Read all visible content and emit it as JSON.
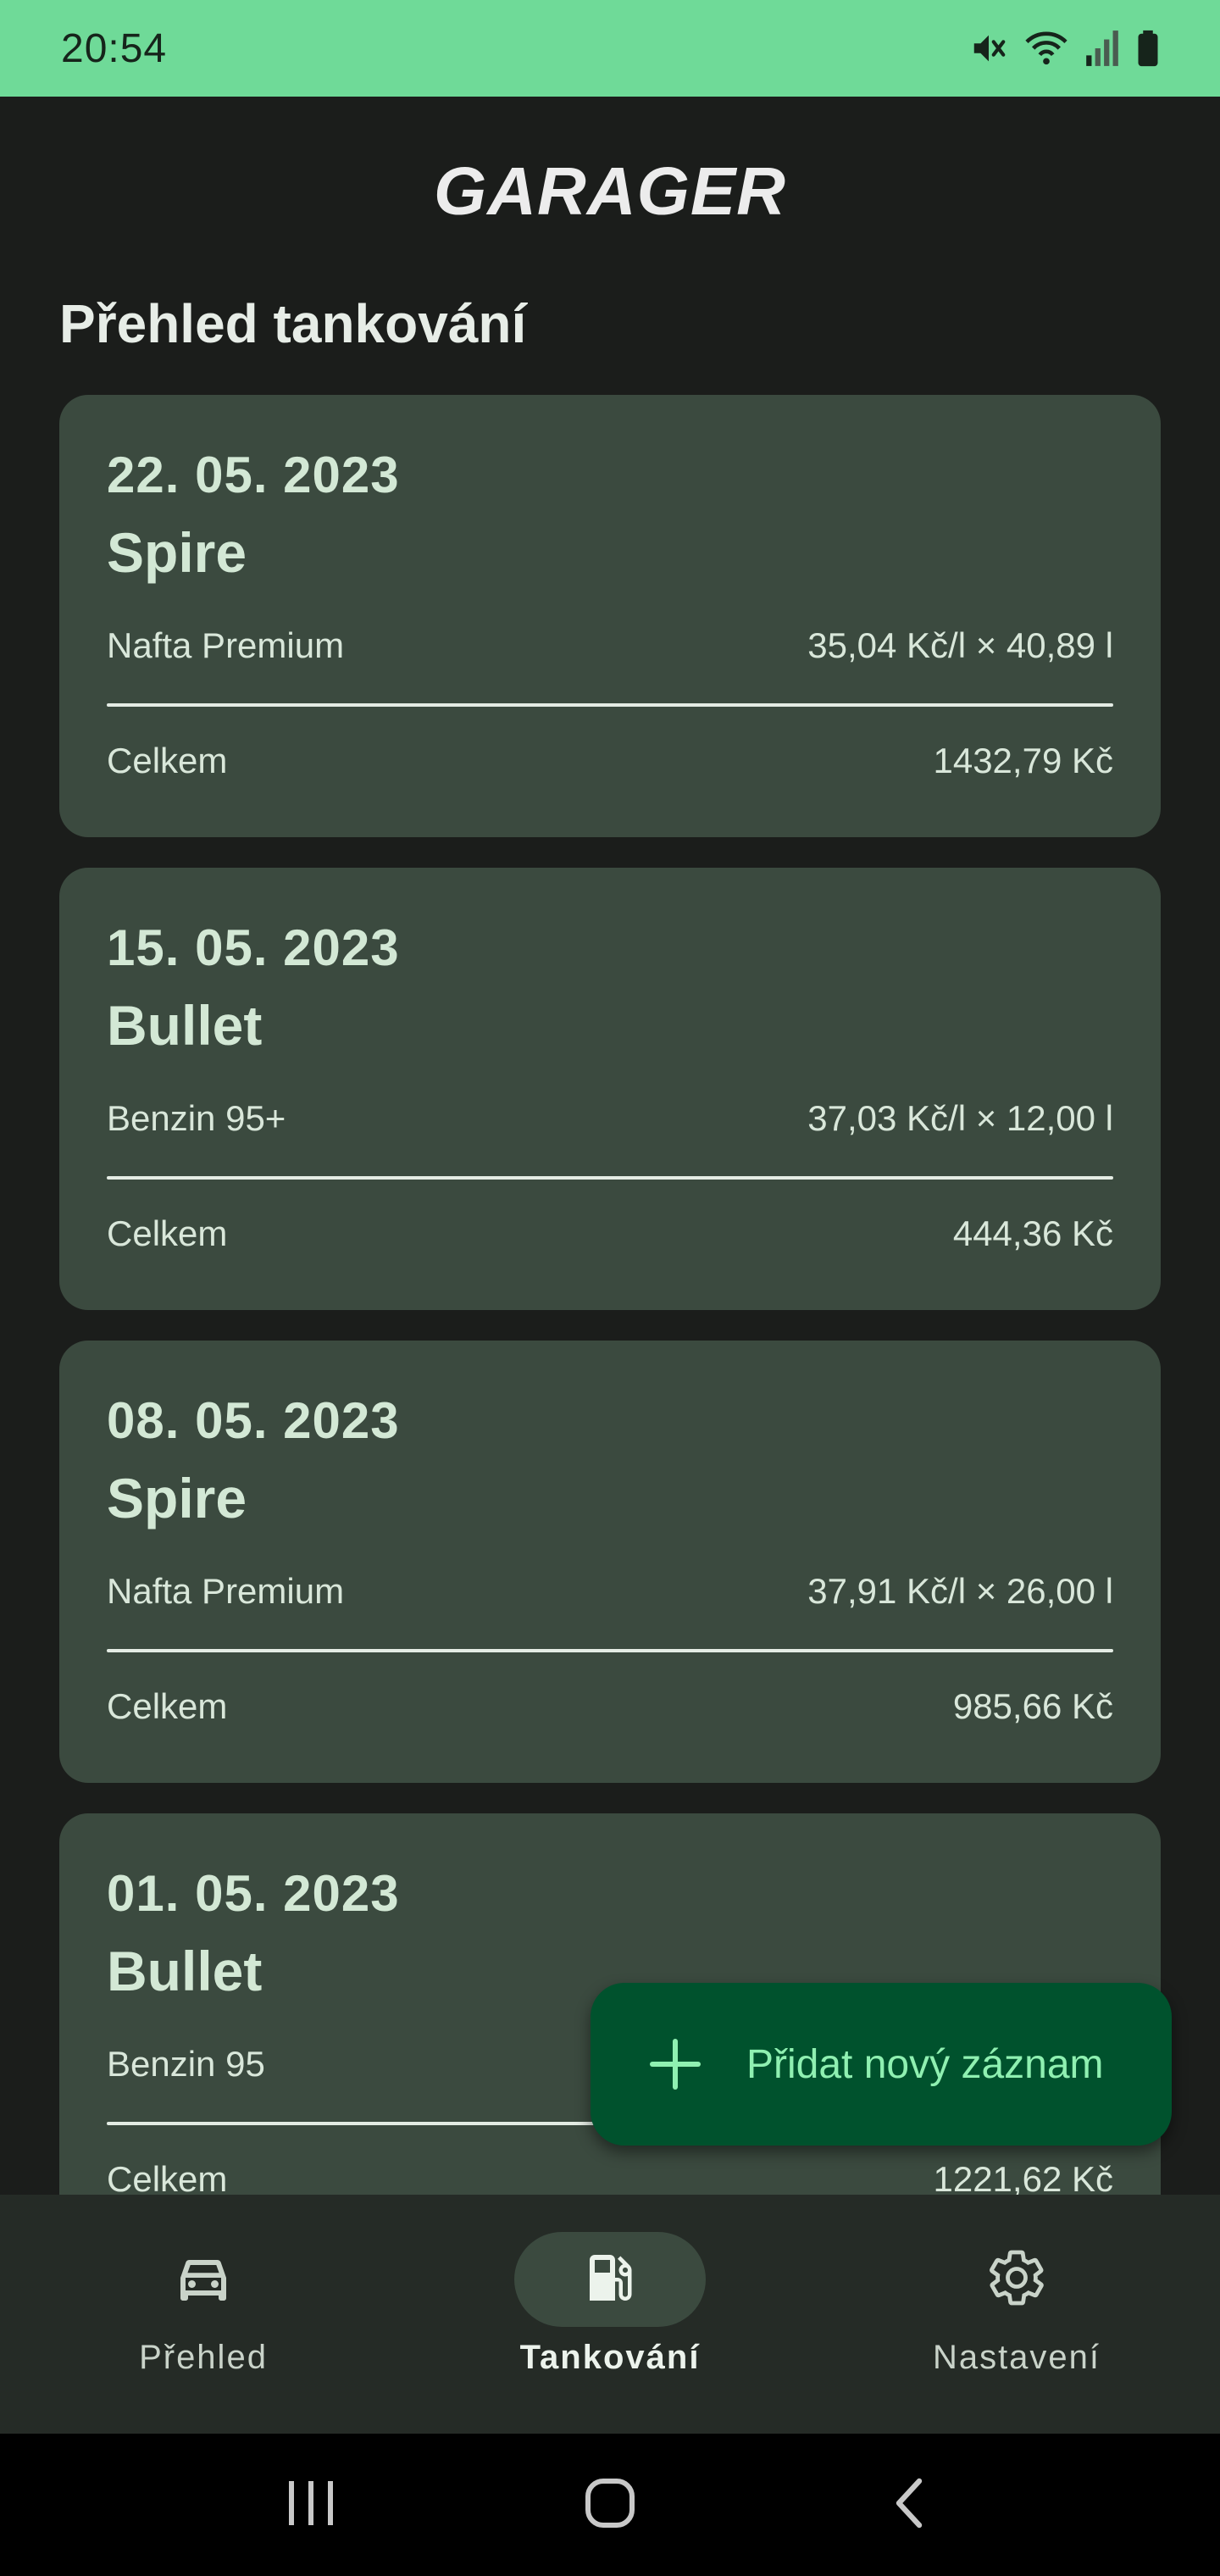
{
  "status_bar": {
    "time": "20:54",
    "icons": [
      "mute-icon",
      "wifi-icon",
      "signal-icon",
      "battery-icon"
    ]
  },
  "app": {
    "title": "GARAGER",
    "section_title": "Přehled tankování"
  },
  "entries": [
    {
      "date": "22. 05. 2023",
      "vehicle": "Spire",
      "fuel": "Nafta Premium",
      "price_volume": "35,04 Kč/l × 40,89 l",
      "total_label": "Celkem",
      "total": "1432,79 Kč"
    },
    {
      "date": "15. 05. 2023",
      "vehicle": "Bullet",
      "fuel": "Benzin 95+",
      "price_volume": "37,03 Kč/l × 12,00 l",
      "total_label": "Celkem",
      "total": "444,36 Kč"
    },
    {
      "date": "08. 05. 2023",
      "vehicle": "Spire",
      "fuel": "Nafta Premium",
      "price_volume": "37,91 Kč/l × 26,00 l",
      "total_label": "Celkem",
      "total": "985,66 Kč"
    },
    {
      "date": "01. 05. 2023",
      "vehicle": "Bullet",
      "fuel": "Benzin 95",
      "price_volume": "",
      "total_label": "Celkem",
      "total": "1221,62 Kč"
    }
  ],
  "fab": {
    "icon": "plus-icon",
    "label": "Přidat nový záznam"
  },
  "bottom_nav": {
    "items": [
      {
        "label": "Přehled",
        "icon": "car-icon",
        "active": false
      },
      {
        "label": "Tankování",
        "icon": "fuel-pump-icon",
        "active": true
      },
      {
        "label": "Nastavení",
        "icon": "gear-icon",
        "active": false
      }
    ]
  },
  "system_nav": {
    "buttons": [
      "recents-icon",
      "home-icon",
      "back-icon"
    ]
  },
  "colors": {
    "status_bar": "#6fda98",
    "background": "#1b1d1b",
    "card": "#3b4a3f",
    "fab": "#00522d",
    "fab_text": "#8ff0b1",
    "nav_bar": "#252b26"
  }
}
